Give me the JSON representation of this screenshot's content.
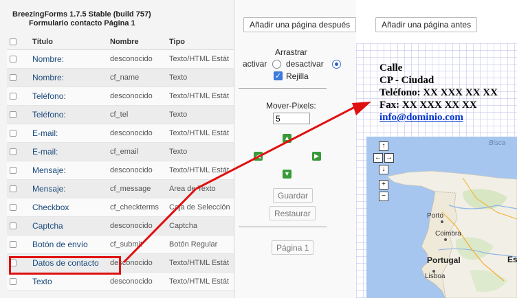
{
  "left_panel": {
    "app_title": "BreezingForms 1.7.5 Stable (build 757)",
    "form_title": "Formulario contacto Página 1",
    "columns": [
      "Título",
      "Nombre",
      "Tipo"
    ],
    "rows": [
      {
        "title": "Nombre:",
        "name": "desconocido",
        "type": "Texto/HTML Estát"
      },
      {
        "title": "Nombre:",
        "name": "cf_name",
        "type": "Texto"
      },
      {
        "title": "Teléfono:",
        "name": "desconocido",
        "type": "Texto/HTML Estát"
      },
      {
        "title": "Teléfono:",
        "name": "cf_tel",
        "type": "Texto"
      },
      {
        "title": "E-mail:",
        "name": "desconocido",
        "type": "Texto/HTML Estát"
      },
      {
        "title": "E-mail:",
        "name": "cf_email",
        "type": "Texto"
      },
      {
        "title": "Mensaje:",
        "name": "desconocido",
        "type": "Texto/HTML Estát"
      },
      {
        "title": "Mensaje:",
        "name": "cf_message",
        "type": "Area de Texto"
      },
      {
        "title": "Checkbox",
        "name": "cf_checkterms",
        "type": "Caja de Selección"
      },
      {
        "title": "Captcha",
        "name": "desconocido",
        "type": "Captcha"
      },
      {
        "title": "Botón de envío",
        "name": "cf_submit",
        "type": "Botón Regular"
      },
      {
        "title": "Datos de contacto",
        "name": "desconocido",
        "type": "Texto/HTML Estát"
      },
      {
        "title": "Texto",
        "name": "desconocido",
        "type": "Texto/HTML Estát"
      }
    ]
  },
  "toolbar": {
    "add_after": "Añadir una página después",
    "add_before": "Añadir una página antes",
    "drag": "Arrastrar",
    "activate": "activar",
    "deactivate": "desactivar",
    "grid": "Rejilla",
    "move_pixels_label": "Mover-Pixels:",
    "move_pixels_value": "5",
    "save": "Guardar",
    "restore": "Restaurar",
    "page": "Página 1"
  },
  "canvas": {
    "street": "Calle",
    "city": "CP - Ciudad",
    "phone": "Teléfono: XX XXX XX XX",
    "fax": "Fax: XX XXX XX XX",
    "email": "info@dominio.com"
  },
  "map": {
    "attribution": "Bisca",
    "country_label": "Portugal",
    "partial_label": "Es",
    "cities": [
      "Porto",
      "Coimbra",
      "Lisboa"
    ],
    "controls": {
      "pan_up": "↑",
      "pan_left": "←",
      "pan_right": "→",
      "pan_down": "↓",
      "zoom_in": "+",
      "zoom_out": "−"
    }
  },
  "icons": {
    "arrow_up": "arrow-up-icon",
    "arrow_left": "arrow-left-icon",
    "arrow_right": "arrow-right-icon",
    "arrow_down": "arrow-down-icon",
    "check": "checkmark-icon"
  },
  "colors": {
    "annotation_red": "#e01010",
    "link_blue": "#0033cc",
    "arrow_green": "#3a9a3a",
    "map_sea": "#a6c6f0",
    "map_land": "#f2efe6"
  }
}
